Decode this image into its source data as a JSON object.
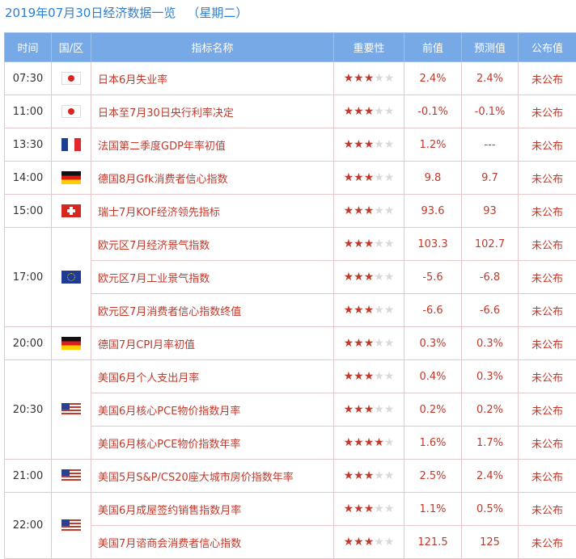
{
  "title": {
    "text": "2019年07月30日经济数据一览",
    "weekday": "（星期二）"
  },
  "columns": [
    "时间",
    "国/区",
    "指标名称",
    "重要性",
    "前值",
    "预测值",
    "公布值"
  ],
  "groups": [
    {
      "time": "07:30",
      "flag": "flag-japan",
      "rows": [
        {
          "name": "日本6月失业率",
          "stars": 3,
          "prev": "2.4%",
          "forecast": "2.4%",
          "actual": "未公布"
        }
      ]
    },
    {
      "time": "11:00",
      "flag": "flag-japan",
      "rows": [
        {
          "name": "日本至7月30日央行利率决定",
          "stars": 3,
          "prev": "-0.1%",
          "forecast": "-0.1%",
          "actual": "未公布"
        }
      ]
    },
    {
      "time": "13:30",
      "flag": "flag-france",
      "rows": [
        {
          "name": "法国第二季度GDP年率初值",
          "stars": 3,
          "prev": "1.2%",
          "forecast": "---",
          "actual": "未公布"
        }
      ]
    },
    {
      "time": "14:00",
      "flag": "flag-germany",
      "rows": [
        {
          "name": "德国8月Gfk消费者信心指数",
          "stars": 3,
          "prev": "9.8",
          "forecast": "9.7",
          "actual": "未公布"
        }
      ]
    },
    {
      "time": "15:00",
      "flag": "flag-switzerland",
      "rows": [
        {
          "name": "瑞士7月KOF经济领先指标",
          "stars": 3,
          "prev": "93.6",
          "forecast": "93",
          "actual": "未公布"
        }
      ]
    },
    {
      "time": "17:00",
      "flag": "flag-eurozone",
      "rows": [
        {
          "name": "欧元区7月经济景气指数",
          "stars": 3,
          "prev": "103.3",
          "forecast": "102.7",
          "actual": "未公布"
        },
        {
          "name": "欧元区7月工业景气指数",
          "stars": 3,
          "prev": "-5.6",
          "forecast": "-6.8",
          "actual": "未公布"
        },
        {
          "name": "欧元区7月消费者信心指数终值",
          "stars": 3,
          "prev": "-6.6",
          "forecast": "-6.6",
          "actual": "未公布"
        }
      ]
    },
    {
      "time": "20:00",
      "flag": "flag-germany",
      "rows": [
        {
          "name": "德国7月CPI月率初值",
          "stars": 3,
          "prev": "0.3%",
          "forecast": "0.3%",
          "actual": "未公布"
        }
      ]
    },
    {
      "time": "20:30",
      "flag": "flag-usa",
      "rows": [
        {
          "name": "美国6月个人支出月率",
          "stars": 3,
          "prev": "0.4%",
          "forecast": "0.3%",
          "actual": "未公布"
        },
        {
          "name": "美国6月核心PCE物价指数月率",
          "stars": 3,
          "prev": "0.2%",
          "forecast": "0.2%",
          "actual": "未公布"
        },
        {
          "name": "美国6月核心PCE物价指数年率",
          "stars": 4,
          "prev": "1.6%",
          "forecast": "1.7%",
          "actual": "未公布"
        }
      ]
    },
    {
      "time": "21:00",
      "flag": "flag-usa",
      "rows": [
        {
          "name": "美国5月S&P/CS20座大城市房价指数年率",
          "stars": 3,
          "prev": "2.5%",
          "forecast": "2.4%",
          "actual": "未公布"
        }
      ]
    },
    {
      "time": "22:00",
      "flag": "flag-usa",
      "rows": [
        {
          "name": "美国6月成屋签约销售指数月率",
          "stars": 3,
          "prev": "1.1%",
          "forecast": "0.5%",
          "actual": "未公布"
        },
        {
          "name": "美国7月谘商会消费者信心指数",
          "stars": 3,
          "prev": "121.5",
          "forecast": "125",
          "actual": "未公布"
        }
      ]
    }
  ],
  "style": {
    "header_bg": "#76a9e6",
    "title_color": "#2b7fd0",
    "value_color": "#c0392b",
    "star_on": "#c0392b",
    "star_off": "#d9d9d9"
  }
}
